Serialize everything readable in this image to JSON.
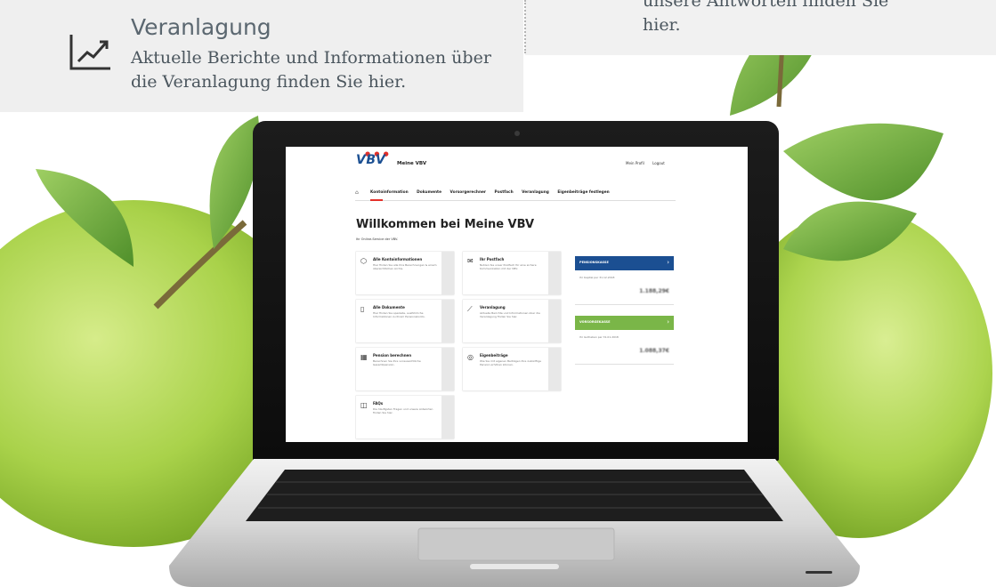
{
  "card_left": {
    "title": "Veranlagung",
    "description": "Aktuelle Berichte und Informationen über die Veranlagung finden Sie hier."
  },
  "card_right": {
    "text": "unsere Antworten finden Sie hier."
  },
  "laptop_screen": {
    "logo": "VBV",
    "app_name": "Meine VBV",
    "top_links": [
      "Mein Profil",
      "Logout"
    ],
    "nav": [
      "Kontoinformation",
      "Dokumente",
      "Vorsorgerechner",
      "Postfach",
      "Veranlagung",
      "Eigenbeiträge festlegen"
    ],
    "heading": "Willkommen bei Meine VBV",
    "subtitle": "Ihr Online-Service der VBV.",
    "tiles": [
      {
        "title": "Alle Kontoinformationen",
        "text": "Hier finden Sie alle Ihre Berechnungen & einem übersichtlichen Archiv."
      },
      {
        "title": "Ihr Postfach",
        "text": "Nutzen Sie unser Postfach für eine sichere Kommunikation mit der VBV."
      },
      {
        "title": "Alle Dokumente",
        "text": "Hier finden Sie spezielle, ausführliche Informationen zu Ihrem Pensionskonto."
      },
      {
        "title": "Veranlagung",
        "text": "Aktuelle Berichte und Informationen über die Veranlagung finden Sie hier."
      },
      {
        "title": "Pension berechnen",
        "text": "Berechnen Sie Ihre voraussichtliche Gesamtpension."
      },
      {
        "title": "Eigenbeiträge",
        "text": "Wie Sie mit eigenen Beiträgen Ihre zukünftige Pension erhöhen können."
      },
      {
        "title": "FAQs",
        "text": "Die häufigsten Fragen und unsere Antworten finden Sie hier."
      }
    ],
    "accounts": [
      {
        "label": "PENSIONSKASSE",
        "date": "Ihr Kapital per 31.12.2018",
        "amount": "1.188,29€",
        "color": "#1b4f92"
      },
      {
        "label": "VORSORGEKASSE",
        "date": "Ihr Guthaben per 31.01.2018",
        "amount": "1.088,37€",
        "color": "#7ab648"
      }
    ]
  },
  "colors": {
    "vbv_blue": "#1b4f92",
    "vbv_green": "#7ab648",
    "vbv_red": "#e4302a",
    "card_bg": "#efefef",
    "text_gray": "#4b565e"
  },
  "icons": [
    "trend-line-icon",
    "cube-icon",
    "mail-icon",
    "document-icon",
    "chart-icon",
    "calculator-icon",
    "coins-icon",
    "chat-icon",
    "home-icon",
    "chevron-right-icon"
  ]
}
